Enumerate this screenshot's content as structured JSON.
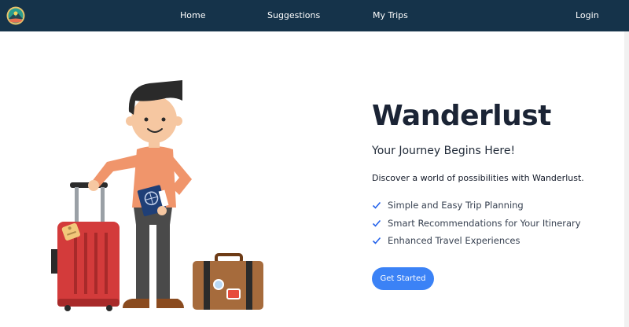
{
  "nav": {
    "links": [
      {
        "label": "Home"
      },
      {
        "label": "Suggestions"
      },
      {
        "label": "My Trips"
      }
    ],
    "login_label": "Login",
    "logo_icon": "mountain-compass-logo-icon"
  },
  "hero": {
    "title": "Wanderlust",
    "subtitle": "Your Journey Begins Here!",
    "description": "Discover a world of possibilities with Wanderlust.",
    "features": [
      "Simple and Easy Trip Planning",
      "Smart Recommendations for Your Itinerary",
      "Enhanced Travel Experiences"
    ],
    "cta_label": "Get Started",
    "illustration_icon": "traveler-with-luggage-illustration"
  },
  "colors": {
    "navbar": "#15334a",
    "accent": "#3b82f6",
    "title": "#1b2435"
  }
}
